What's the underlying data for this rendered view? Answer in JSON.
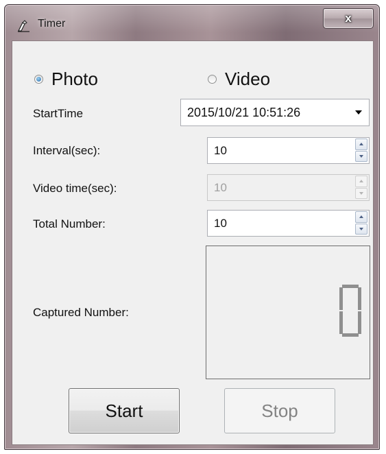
{
  "window": {
    "title": "Timer",
    "close_label": "x"
  },
  "mode": {
    "photo_label": "Photo",
    "video_label": "Video",
    "selected": "Photo"
  },
  "fields": {
    "start_time_label": "StartTime",
    "start_time_value": "2015/10/21 10:51:26",
    "interval_label": "Interval(sec):",
    "interval_value": "10",
    "video_time_label": "Video time(sec):",
    "video_time_value": "10",
    "total_number_label": "Total Number:",
    "total_number_value": "10",
    "captured_number_label": "Captured Number:",
    "captured_number_value": "0"
  },
  "buttons": {
    "start_label": "Start",
    "stop_label": "Stop"
  },
  "icons": {
    "app": "flashlight-icon",
    "spin_up": "arrow-up-icon",
    "spin_down": "arrow-down-icon",
    "dropdown": "chevron-down-icon"
  },
  "colors": {
    "radio_selected": "#2b6aa8",
    "lcd_digit": "#8f8f8f",
    "frame": "#9f8c92"
  }
}
